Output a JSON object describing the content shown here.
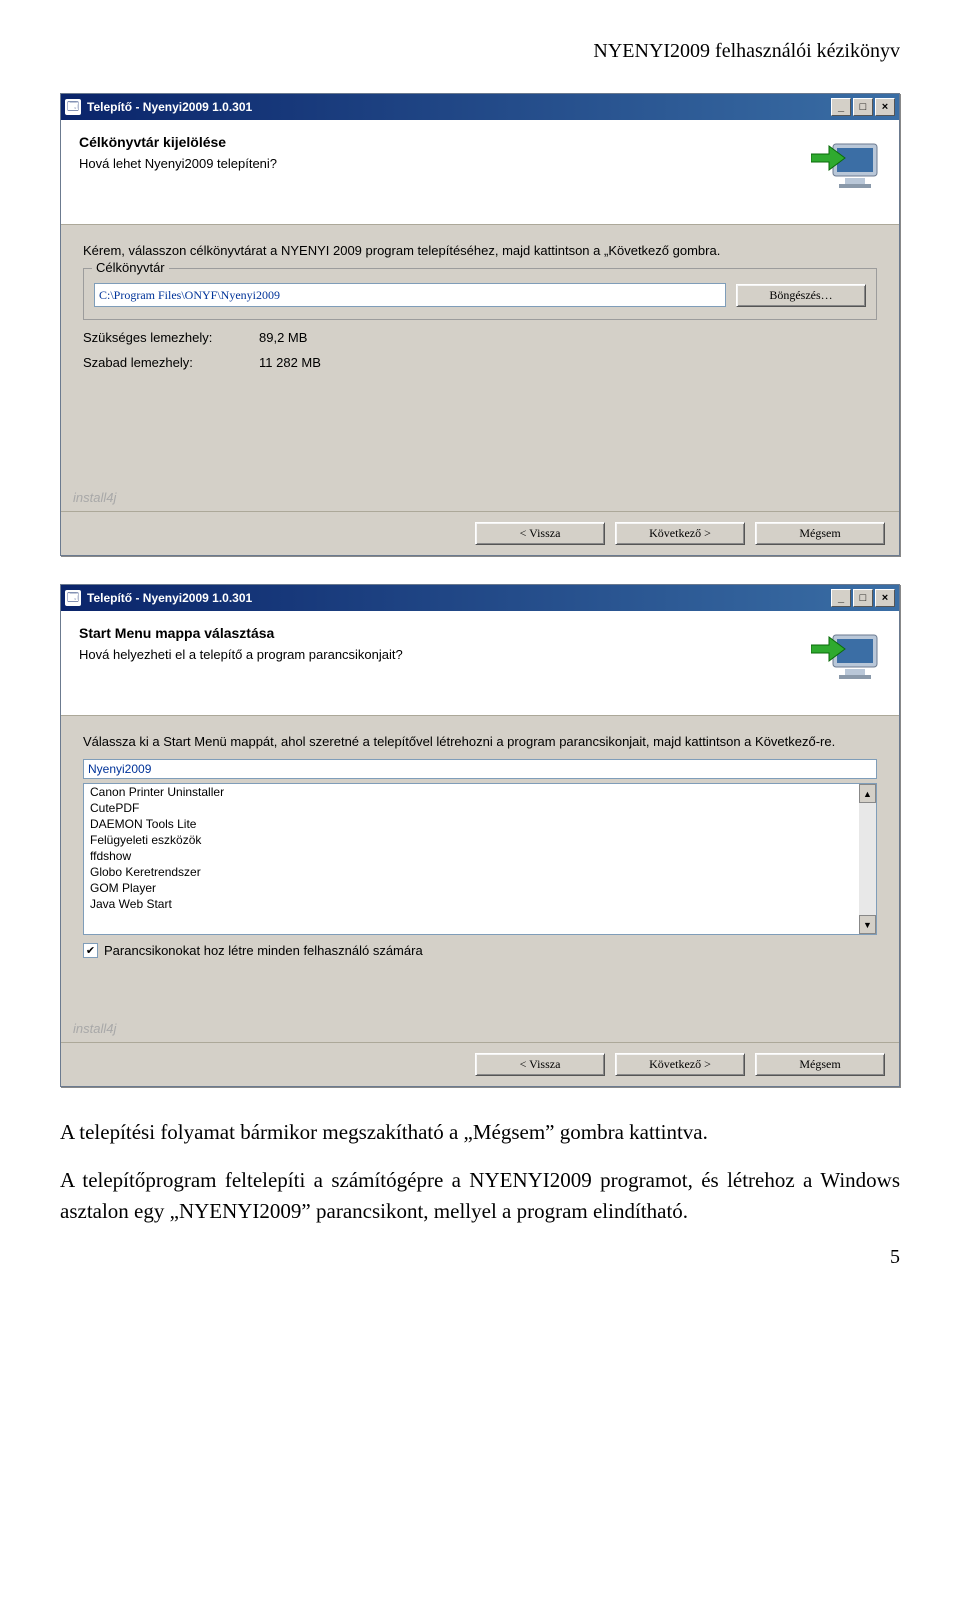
{
  "doc": {
    "header": "NYENYI2009 felhasználói kézikönyv",
    "para1": "A telepítési folyamat bármikor megszakítható a „Mégsem” gombra kattintva.",
    "para2": "A telepítőprogram feltelepíti a számítógépre a NYENYI2009 programot, és létrehoz a Windows asztalon egy „NYENYI2009” parancsikont, mellyel a program elindítható.",
    "pagenum": "5"
  },
  "win1": {
    "title": "Telepítő - Nyenyi2009 1.0.301",
    "header_title": "Célkönyvtár kijelölése",
    "header_sub": "Hová lehet Nyenyi2009 telepíteni?",
    "instruction": "Kérem, válasszon célkönyvtárat a NYENYI 2009 program telepítéséhez, majd kattintson a „Következő gombra.",
    "group_label": "Célkönyvtár",
    "path_value": "C:\\Program Files\\ONYF\\Nyenyi2009",
    "browse": "Böngészés…",
    "req_label": "Szükséges lemezhely:",
    "req_value": "89,2 MB",
    "free_label": "Szabad lemezhely:",
    "free_value": "11 282 MB",
    "watermark": "install4j",
    "back": "< Vissza",
    "next": "Következő >",
    "cancel": "Mégsem"
  },
  "win2": {
    "title": "Telepítő - Nyenyi2009 1.0.301",
    "header_title": "Start Menu mappa választása",
    "header_sub": "Hová helyezheti el a telepítő a program parancsikonjait?",
    "instruction": "Válassza ki a Start Menü mappát, ahol szeretné a telepítővel létrehozni a program parancsikonjait, majd kattintson a Következő-re.",
    "input_value": "Nyenyi2009",
    "items": [
      "Canon Printer Uninstaller",
      "CutePDF",
      "DAEMON Tools Lite",
      "Felügyeleti eszközök",
      "ffdshow",
      "Globo Keretrendszer",
      "GOM Player",
      "Java Web Start"
    ],
    "checkbox_label": "Parancsikonokat hoz létre minden felhasználó számára",
    "watermark": "install4j",
    "back": "< Vissza",
    "next": "Következő >",
    "cancel": "Mégsem"
  }
}
